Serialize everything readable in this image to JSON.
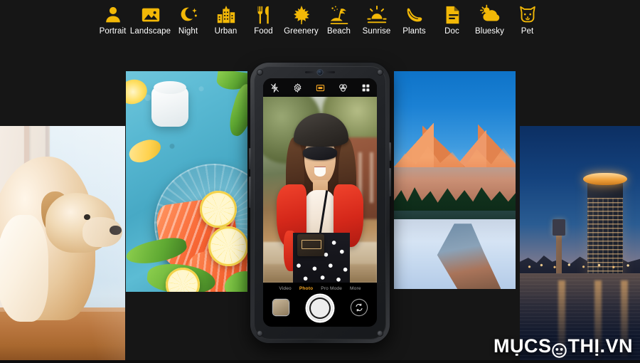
{
  "background_color": "#161616",
  "accent_color": "#f2b807",
  "scene_bar": {
    "items": [
      {
        "label": "Portrait",
        "icon": "portrait-icon"
      },
      {
        "label": "Landscape",
        "icon": "landscape-icon"
      },
      {
        "label": "Night",
        "icon": "night-icon"
      },
      {
        "label": "Urban",
        "icon": "urban-icon"
      },
      {
        "label": "Food",
        "icon": "food-icon"
      },
      {
        "label": "Greenery",
        "icon": "greenery-icon"
      },
      {
        "label": "Beach",
        "icon": "beach-icon"
      },
      {
        "label": "Sunrise",
        "icon": "sunrise-icon"
      },
      {
        "label": "Plants",
        "icon": "plants-icon"
      },
      {
        "label": "Doc",
        "icon": "doc-icon"
      },
      {
        "label": "Bluesky",
        "icon": "bluesky-icon"
      },
      {
        "label": "Pet",
        "icon": "pet-icon"
      }
    ]
  },
  "gallery": {
    "panels": [
      {
        "name": "dog-photo",
        "subject": "Golden retriever dog looking out of a window"
      },
      {
        "name": "food-photo",
        "subject": "Salmon fillets with lemon slices on a blue table"
      },
      {
        "name": "snow-photo",
        "subject": "Snowy alpine valley with orange sunlit peaks and a stream"
      },
      {
        "name": "city-photo",
        "subject": "City skyline at dusk with illuminated tower reflected in water"
      }
    ]
  },
  "phone": {
    "camera_ui": {
      "top_icons": [
        {
          "name": "flash-icon",
          "label": "Flash"
        },
        {
          "name": "settings-icon",
          "label": "Settings"
        },
        {
          "name": "ai-scene-icon",
          "label": "AI Scene",
          "active": true
        },
        {
          "name": "filter-icon",
          "label": "Filters"
        },
        {
          "name": "grid-icon",
          "label": "More"
        }
      ],
      "modes": [
        {
          "label": "Video",
          "active": false
        },
        {
          "label": "Photo",
          "active": true
        },
        {
          "label": "Pro Mode",
          "active": false
        },
        {
          "label": "More",
          "active": false
        }
      ],
      "shutter_label": "Shutter",
      "thumbnail_label": "Last photo",
      "switch_label": "Switch camera"
    },
    "viewfinder": {
      "subject": "Woman in a black beret, sunglasses, red jacket and polka-dot skirt"
    }
  },
  "watermark": {
    "text_before": "MỤCS",
    "text_after": "THỊ.VN",
    "full_text": "MỤCSỐTHỊ.VN"
  }
}
